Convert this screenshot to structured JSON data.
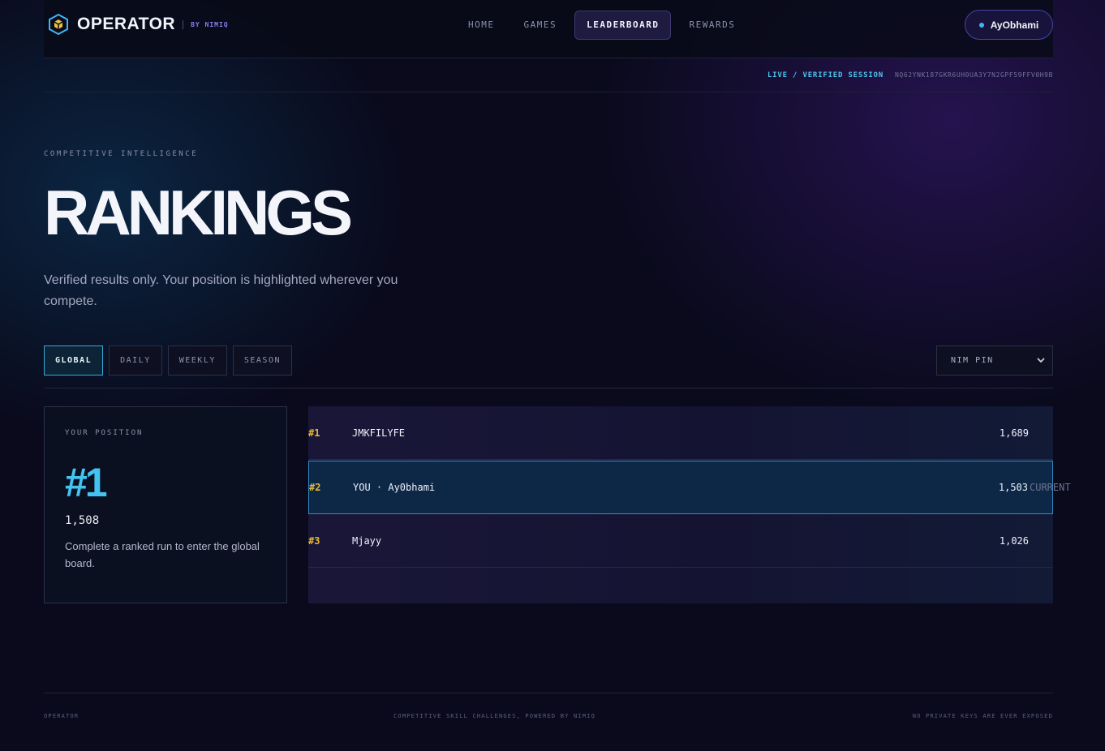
{
  "brand": {
    "name": "OPERATOR",
    "by": "BY NIMIQ"
  },
  "nav": {
    "items": [
      {
        "label": "HOME",
        "active": false
      },
      {
        "label": "GAMES",
        "active": false
      },
      {
        "label": "LEADERBOARD",
        "active": true
      },
      {
        "label": "REWARDS",
        "active": false
      }
    ]
  },
  "user": {
    "name": "AyObhami"
  },
  "session": {
    "status": "LIVE / VERIFIED SESSION",
    "id": "NQ62YNK187GKR6UH0UA3Y7N2GPF59FFV0H9B"
  },
  "hero": {
    "kicker": "COMPETITIVE INTELLIGENCE",
    "title": "RANKINGS",
    "subtitle": "Verified results only. Your position is highlighted wherever you compete."
  },
  "tabs": [
    {
      "label": "GLOBAL",
      "active": true
    },
    {
      "label": "DAILY",
      "active": false
    },
    {
      "label": "WEEKLY",
      "active": false
    },
    {
      "label": "SEASON",
      "active": false
    }
  ],
  "filter": {
    "selected": "NIM PIN"
  },
  "position": {
    "label": "YOUR POSITION",
    "rank": "#1",
    "score": "1,508",
    "note": "Complete a ranked run to enter the global board."
  },
  "board": {
    "rows": [
      {
        "rank": "#1",
        "name": "JMKFILYFE",
        "score": "1,689",
        "me": false
      },
      {
        "rank": "#2",
        "name": "YOU · Ay0bhami",
        "score": "1,503",
        "me": true,
        "tag": "CURRENT"
      },
      {
        "rank": "#3",
        "name": "Mjayy",
        "score": "1,026",
        "me": false
      }
    ]
  },
  "footer": {
    "left": "OPERATOR",
    "center": "COMPETITIVE SKILL CHALLENGES, POWERED BY NIMIQ",
    "right": "NO PRIVATE KEYS ARE EVER EXPOSED"
  },
  "colors": {
    "accent": "#44c3f0",
    "rank_gold": "#e6b93a",
    "brand_purple": "#8f7cf0",
    "bg": "#0a0a1c"
  }
}
